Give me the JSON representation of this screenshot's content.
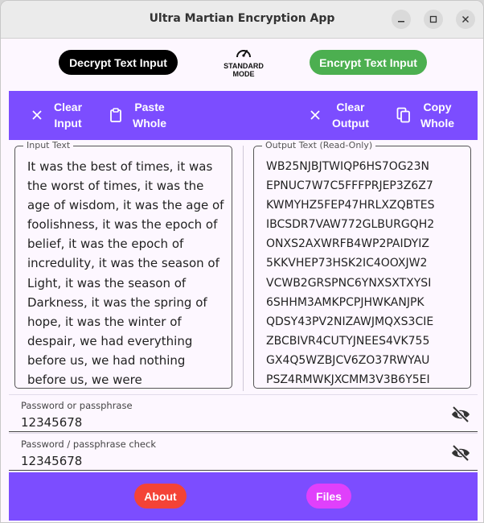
{
  "window": {
    "title": "Ultra Martian Encryption App",
    "controls": [
      "minimize",
      "maximize",
      "close"
    ]
  },
  "topbar": {
    "decrypt_label": "Decrypt Text Input",
    "encrypt_label": "Encrypt Text Input",
    "mode_line1": "STANDARD",
    "mode_line2": "MODE"
  },
  "toolbar": {
    "clear_input": "Clear\nInput",
    "paste_whole": "Paste\nWhole",
    "clear_output": "Clear\nOutput",
    "copy_whole": "Copy\nWhole"
  },
  "input": {
    "label": "Input Text",
    "value": "It was the best of times, it was the worst of times, it was the age of wisdom, it was the age of foolishness, it was the epoch of belief, it was the epoch of incredulity, it was the season of Light, it was the season of Darkness, it was the spring of hope, it was the winter of despair, we had everything before us, we had nothing before us, we were"
  },
  "output": {
    "label": "Output Text (Read-Only)",
    "lines": [
      "WB25NJBJTWIQP6HS7OG23N",
      "EPNUC7W7C5FFFPRJEP3Z6Z7",
      "KWMYHZ5FEP47HRLXZQBTES",
      "IBCSDR7VAW772GLBURGQH2",
      "ONXS2AXWRFB4WP2PAIDYIZ",
      "5KKVHEP73HSK2IC4OOXJW2",
      "VCWB2GRSPNC6YNXSXTXYSI",
      "6SHHM3AMKPCPJHWKANJPK",
      "QDSY43PV2NIZAWJMQXS3CIE",
      "ZBCBIVR4CUTYJNEES4VK755",
      "GX4Q5WZBJCV6ZO37RWYAU",
      "PSZ4RMWKJXCMM3V3B6Y5EI"
    ]
  },
  "password": {
    "label": "Password or passphrase",
    "value": "12345678"
  },
  "password_check": {
    "label": "Password / passphrase check",
    "value": "12345678"
  },
  "bottom": {
    "about_label": "About",
    "files_label": "Files"
  },
  "colors": {
    "accent_purple": "#7c4dff",
    "decrypt_black": "#000000",
    "encrypt_green": "#4caf50",
    "about_red": "#f44336",
    "files_magenta": "#e040fb"
  }
}
